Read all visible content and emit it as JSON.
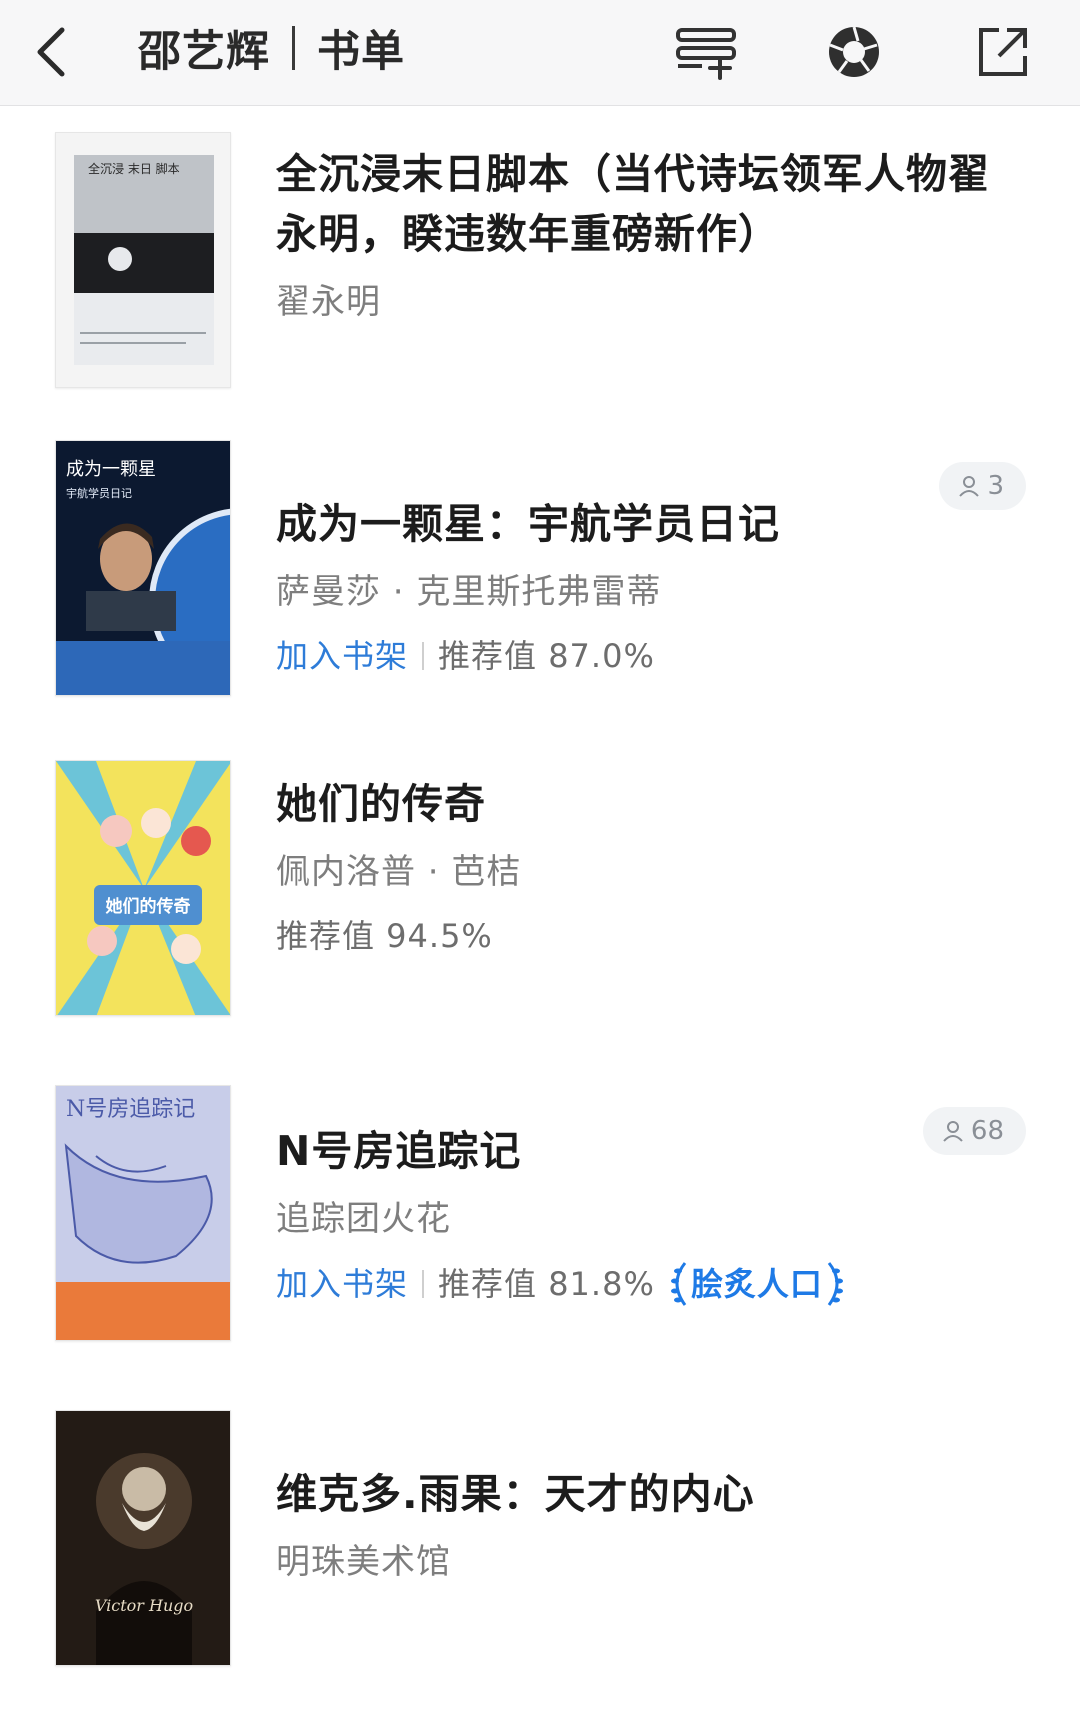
{
  "header": {
    "title_name": "邵艺辉",
    "title_section": "书单",
    "icons": [
      "back-icon",
      "add-list-icon",
      "aperture-icon",
      "share-icon"
    ]
  },
  "books": [
    {
      "title": "全沉浸末日脚本（当代诗坛领军人物翟永明，睽违数年重磅新作）",
      "author": "翟永明",
      "cover_text": "全沉浸 末日 脚本",
      "cover_colors": [
        "#c9ccd0",
        "#1e1f22",
        "#e9ebee"
      ]
    },
    {
      "title": "成为一颗星：宇航学员日记",
      "author": "萨曼莎 · 克里斯托弗雷蒂",
      "add_shelf": "加入书架",
      "rating": "推荐值 87.0%",
      "readers": "3",
      "cover_text": "成为一颗星",
      "cover_subtext": "宇航学员日记",
      "cover_colors": [
        "#0c1930",
        "#2a6dc2",
        "#f0f4fa"
      ]
    },
    {
      "title": "她们的传奇",
      "author": "佩内洛普 · 芭桔",
      "rating": "推荐值 94.5%",
      "cover_text": "她们的传奇",
      "cover_colors": [
        "#f3e35c",
        "#6cc4d8",
        "#e5584f"
      ]
    },
    {
      "title": "N号房追踪记",
      "author": "追踪团火花",
      "add_shelf": "加入书架",
      "rating": "推荐值 81.8%",
      "award": "脍炙人口",
      "readers": "68",
      "cover_text": "N号房追踪记",
      "cover_colors": [
        "#c8cde9",
        "#4b5aa8",
        "#ea7a3a"
      ]
    },
    {
      "title": "维克多.雨果：天才的内心",
      "author": "明珠美术馆",
      "cover_text": "Victor Hugo",
      "cover_colors": [
        "#231b15",
        "#4a3a2c",
        "#c9bba6"
      ]
    }
  ],
  "colors": {
    "accent": "#2e7cd8",
    "award": "#1e7ae6",
    "muted": "#7e7e7e"
  }
}
